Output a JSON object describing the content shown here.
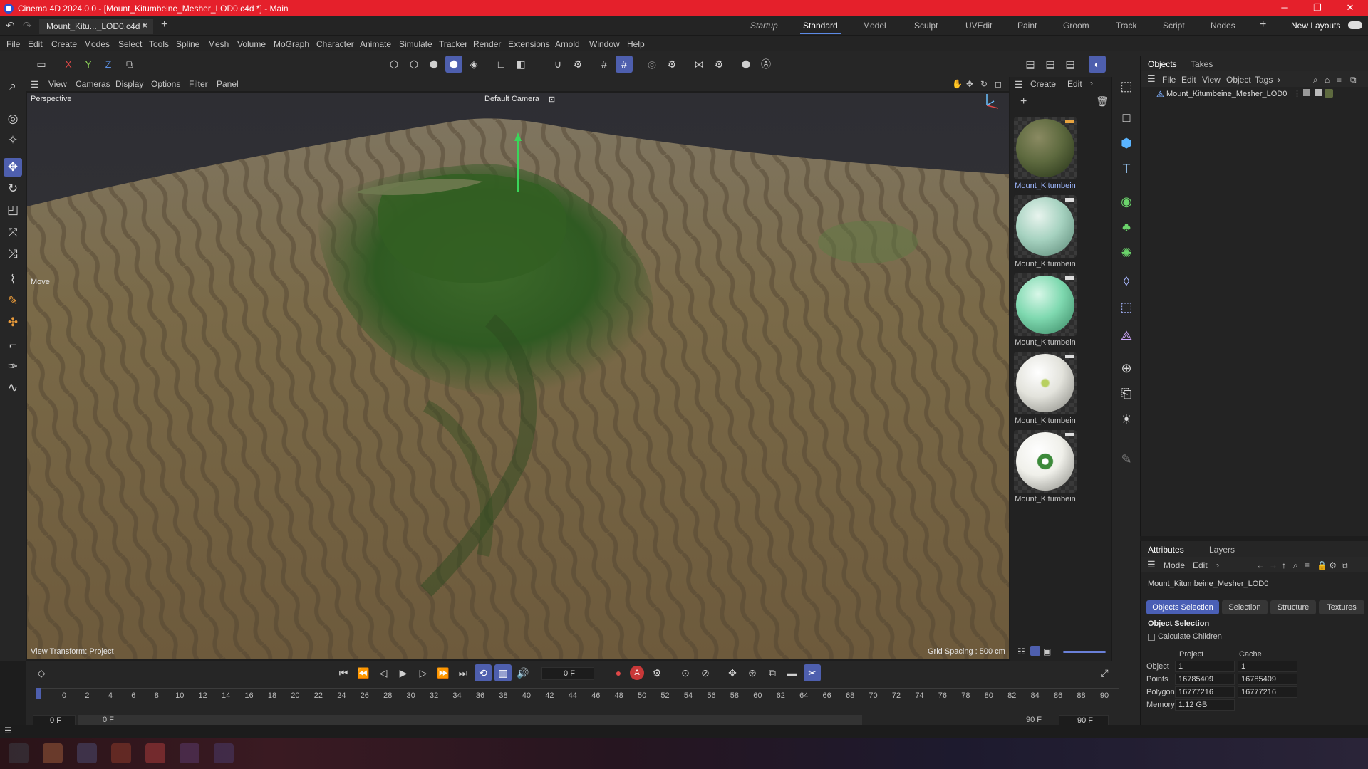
{
  "window": {
    "title": "Cinema 4D 2024.0.0 - [Mount_Kitumbeine_Mesher_LOD0.c4d *] - Main"
  },
  "doc_tab": {
    "label": "Mount_Kitu..._LOD0.c4d *",
    "close": "×",
    "add": "+"
  },
  "layouts": [
    "Startup",
    "Standard",
    "Model",
    "Sculpt",
    "UVEdit",
    "Paint",
    "Groom",
    "Track",
    "Script",
    "Nodes"
  ],
  "layouts_active": "Standard",
  "new_layouts": "New Layouts",
  "menu": [
    "File",
    "Edit",
    "Create",
    "Modes",
    "Select",
    "Tools",
    "Spline",
    "Mesh",
    "Volume",
    "MoGraph",
    "Character",
    "Animate",
    "Simulate",
    "Tracker",
    "Render",
    "Extensions",
    "Arnold",
    "Window",
    "Help"
  ],
  "axis_buttons": {
    "x": "X",
    "y": "Y",
    "z": "Z"
  },
  "viewport_menu": [
    "View",
    "Cameras",
    "Display",
    "Options",
    "Filter",
    "Panel"
  ],
  "viewport": {
    "view_name": "Perspective",
    "camera": "Default Camera",
    "tool_label": "Move",
    "view_transform": "View Transform: Project",
    "grid_spacing": "Grid Spacing : 500 cm"
  },
  "material_menu": [
    "Create",
    "Edit"
  ],
  "materials": [
    {
      "label": "Mount_Kitumbein",
      "color": "#5e6a3f"
    },
    {
      "label": "Mount_Kitumbein",
      "color": "#a6d2c0"
    },
    {
      "label": "Mount_Kitumbein",
      "color": "#7fd9b0"
    },
    {
      "label": "Mount_Kitumbein",
      "color": "#e3e3dc"
    },
    {
      "label": "Mount_Kitumbein",
      "color": "#f0f0ea"
    }
  ],
  "objects_panel": {
    "tabs": [
      "Objects",
      "Takes"
    ],
    "menu": [
      "File",
      "Edit",
      "View",
      "Object",
      "Tags"
    ],
    "object_name": "Mount_Kitumbeine_Mesher_LOD0"
  },
  "attributes_panel": {
    "tabs": [
      "Attributes",
      "Layers"
    ],
    "menu": [
      "Mode",
      "Edit"
    ],
    "object_name": "Mount_Kitumbeine_Mesher_LOD0",
    "subtabs": [
      "Objects Selection",
      "Selection",
      "Structure",
      "Textures"
    ],
    "section": "Object Selection",
    "calc_children": "Calculate Children",
    "col_project": "Project",
    "col_cache": "Cache",
    "rows": [
      {
        "label": "Object",
        "project": "1",
        "cache": "1"
      },
      {
        "label": "Points",
        "project": "16785409",
        "cache": "16785409"
      },
      {
        "label": "Polygons",
        "project": "16777216",
        "cache": "16777216"
      },
      {
        "label": "Memory",
        "project": "1.12 GB",
        "cache": ""
      }
    ]
  },
  "timeline": {
    "current_frame": "0 F",
    "ticks": [
      "0",
      "2",
      "4",
      "6",
      "8",
      "10",
      "12",
      "14",
      "16",
      "18",
      "20",
      "22",
      "24",
      "26",
      "28",
      "30",
      "32",
      "34",
      "36",
      "38",
      "40",
      "42",
      "44",
      "46",
      "48",
      "50",
      "52",
      "54",
      "56",
      "58",
      "60",
      "62",
      "64",
      "66",
      "68",
      "70",
      "72",
      "74",
      "76",
      "78",
      "80",
      "82",
      "84",
      "86",
      "88",
      "90"
    ],
    "start": "0 F",
    "min": "0 F",
    "max": "90 F",
    "end": "90 F",
    "key_a": "A"
  }
}
